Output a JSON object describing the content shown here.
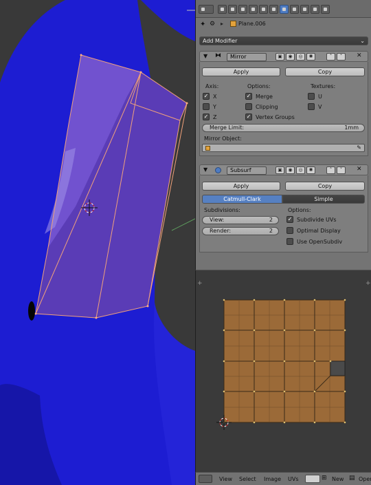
{
  "properties": {
    "object_name": "Plane.006",
    "add_modifier_label": "Add Modifier",
    "mirror": {
      "name": "Mirror",
      "apply_label": "Apply",
      "copy_label": "Copy",
      "axis_heading": "Axis:",
      "options_heading": "Options:",
      "textures_heading": "Textures:",
      "axis_x": "X",
      "axis_y": "Y",
      "axis_z": "Z",
      "merge": "Merge",
      "clipping": "Clipping",
      "vertex_groups": "Vertex Groups",
      "tex_u": "U",
      "tex_v": "V",
      "merge_limit_label": "Merge Limit:",
      "merge_limit_value": "1mm",
      "mirror_object_label": "Mirror Object:"
    },
    "subsurf": {
      "name": "Subsurf",
      "apply_label": "Apply",
      "copy_label": "Copy",
      "tab_catmull": "Catmull-Clark",
      "tab_simple": "Simple",
      "subdivisions_heading": "Subdivisions:",
      "options_heading": "Options:",
      "view_label": "View:",
      "view_value": "2",
      "render_label": "Render:",
      "render_value": "2",
      "subdivide_uvs": "Subdivide UVs",
      "optimal_display": "Optimal Display",
      "use_opensubdiv": "Use OpenSubdiv"
    }
  },
  "uv_editor": {
    "menu_view": "View",
    "menu_select": "Select",
    "menu_image": "Image",
    "menu_uvs": "UVs",
    "new_label": "New",
    "open_label": "Open"
  },
  "colors": {
    "mesh_blue": "#1f1fd6",
    "mesh_purple": "#5d3fb8",
    "selected_edge": "#f0a070",
    "uv_fill": "#9b6a38",
    "active_tab": "#5680c2"
  }
}
